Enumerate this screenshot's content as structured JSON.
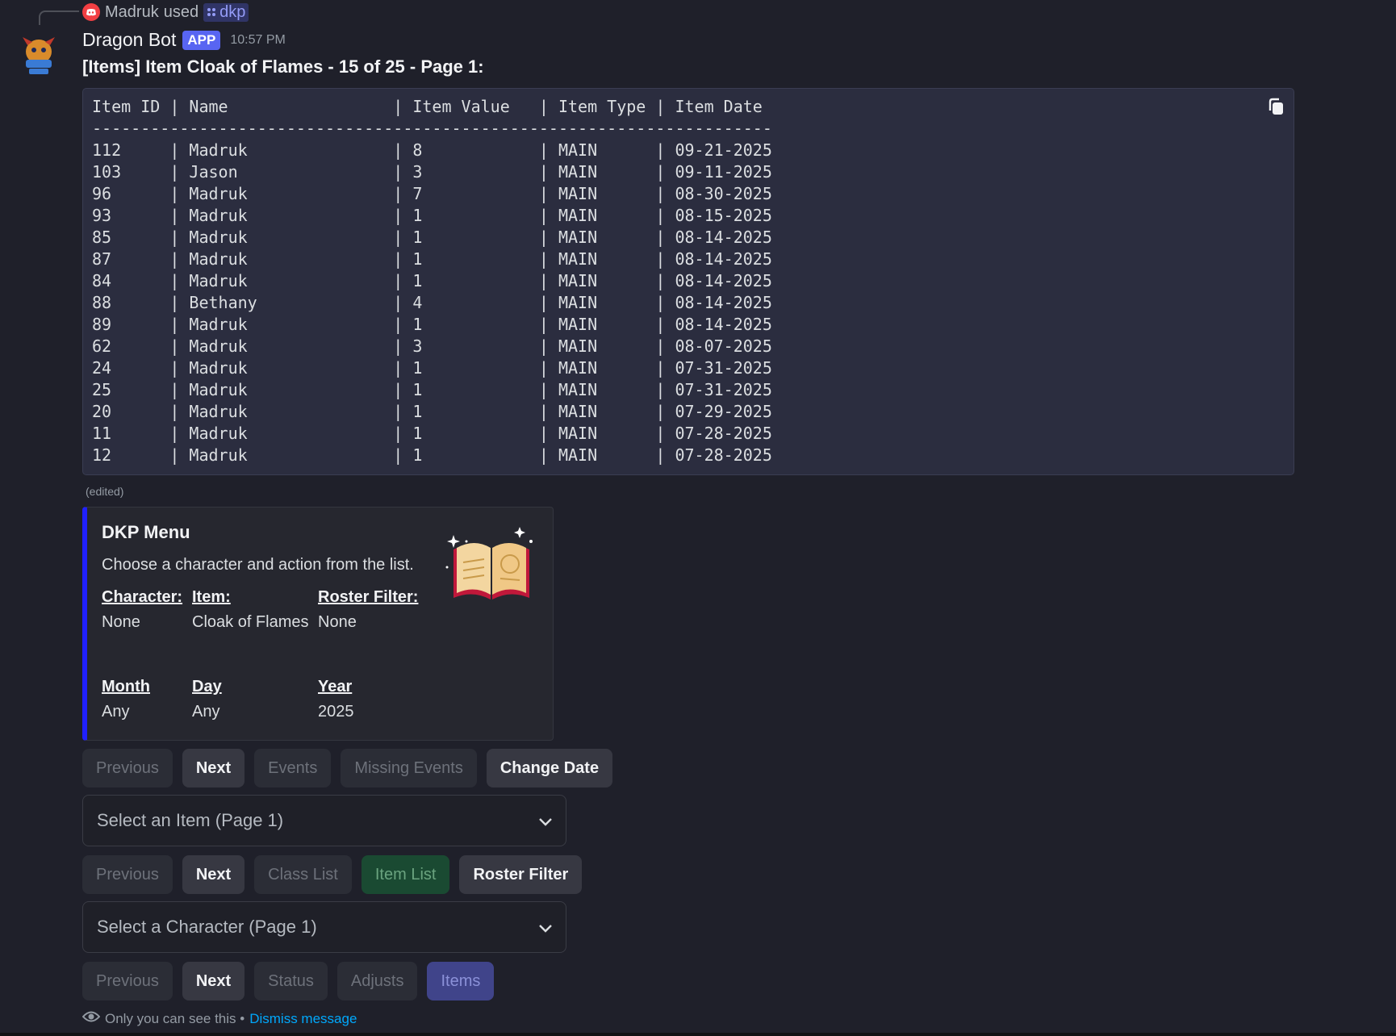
{
  "reply": {
    "user": "Madruk",
    "verb": "used",
    "command": "dkp"
  },
  "message": {
    "username": "Dragon Bot",
    "tag": "APP",
    "timestamp": "10:57 PM",
    "title": "[Items] Item Cloak of Flames - 15 of 25 - Page 1:",
    "edited": "(edited)"
  },
  "code_block": {
    "lines": [
      "Item ID | Name                 | Item Value   | Item Type | Item Date",
      "----------------------------------------------------------------------",
      "112     | Madruk               | 8            | MAIN      | 09-21-2025",
      "103     | Jason                | 3            | MAIN      | 09-11-2025",
      "96      | Madruk               | 7            | MAIN      | 08-30-2025",
      "93      | Madruk               | 1            | MAIN      | 08-15-2025",
      "85      | Madruk               | 1            | MAIN      | 08-14-2025",
      "87      | Madruk               | 1            | MAIN      | 08-14-2025",
      "84      | Madruk               | 1            | MAIN      | 08-14-2025",
      "88      | Bethany              | 4            | MAIN      | 08-14-2025",
      "89      | Madruk               | 1            | MAIN      | 08-14-2025",
      "62      | Madruk               | 3            | MAIN      | 08-07-2025",
      "24      | Madruk               | 1            | MAIN      | 07-31-2025",
      "25      | Madruk               | 1            | MAIN      | 07-31-2025",
      "20      | Madruk               | 1            | MAIN      | 07-29-2025",
      "11      | Madruk               | 1            | MAIN      | 07-28-2025",
      "12      | Madruk               | 1            | MAIN      | 07-28-2025"
    ]
  },
  "embed": {
    "title": "DKP Menu",
    "description": "Choose a character and action from the list.",
    "accent": "#2020ff",
    "fields": [
      {
        "name": "Character:",
        "value": "None"
      },
      {
        "name": "Item:",
        "value": "Cloak of Flames"
      },
      {
        "name": "Roster Filter:",
        "value": "None"
      },
      {
        "name": "Month",
        "value": "Any"
      },
      {
        "name": "Day",
        "value": "Any"
      },
      {
        "name": "Year",
        "value": "2025"
      }
    ]
  },
  "row1": [
    "Previous",
    "Next",
    "Events",
    "Missing Events",
    "Change Date"
  ],
  "select_item": {
    "placeholder": "Select an Item (Page 1)"
  },
  "row2": [
    "Previous",
    "Next",
    "Class List",
    "Item List",
    "Roster Filter"
  ],
  "select_character": {
    "placeholder": "Select a Character (Page 1)"
  },
  "row3": [
    "Previous",
    "Next",
    "Status",
    "Adjusts",
    "Items"
  ],
  "footer": {
    "text": "Only you can see this •",
    "link": "Dismiss message"
  },
  "colors": {
    "background": "#1f202a",
    "app_tag": "#5865f2",
    "green_button": "#1a4a32",
    "blurple_button": "#40448a",
    "link": "#00a8fc"
  }
}
